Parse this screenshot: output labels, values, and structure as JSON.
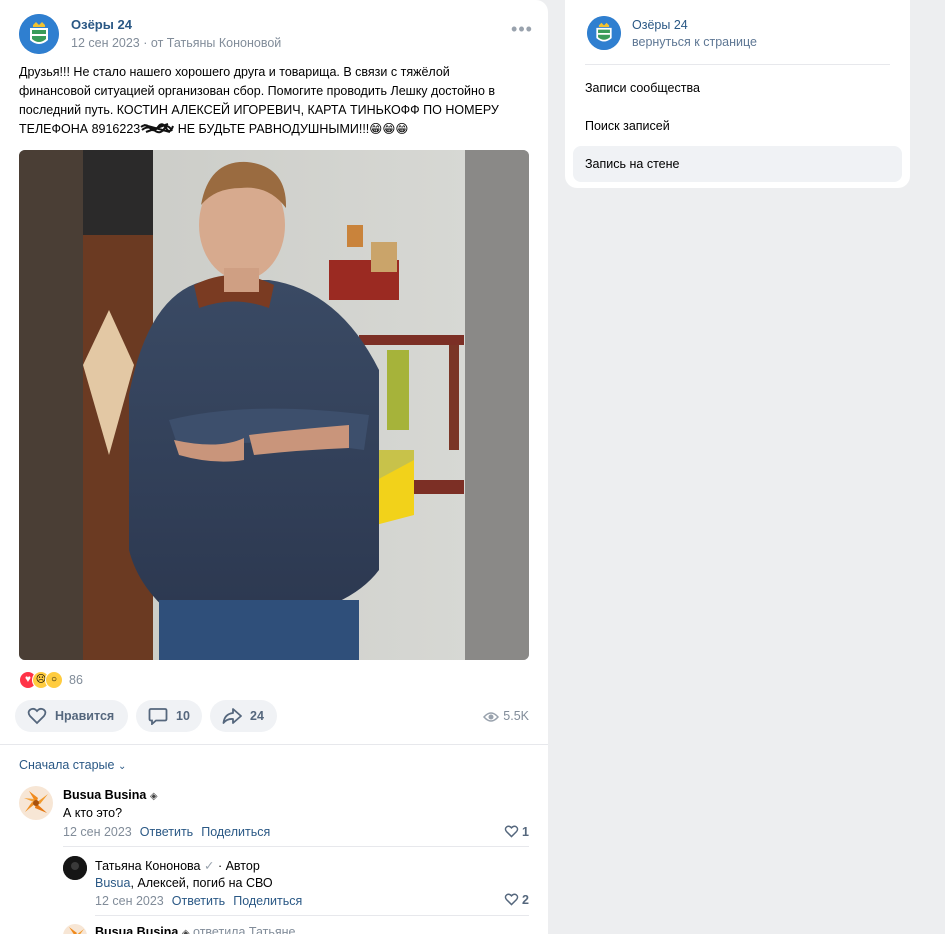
{
  "post": {
    "author": "Озёры 24",
    "date": "12 сен 2023",
    "from": "от Татьяны Кононовой",
    "more": "•••",
    "text_lines": [
      "Друзья!!! Не стало нашего хорошего друга и товарища. В связи с тяжёлой",
      "финансовой ситуацией организован сбор. Помогите проводить Лешку достойно в",
      "последний путь. КОСТИН АЛЕКСЕЙ ИГОРЕВИЧ, КАРТА ТИНЬКОФФ ПО НОМЕРУ",
      "ТЕЛЕФОНА 8916223"
    ],
    "text_tail": " НЕ БУДЬТЕ РАВНОДУШНЫМИ!!!😁😁😁",
    "reactions_count": "86",
    "like_label": "Нравится",
    "comments_count": "10",
    "shares_count": "24",
    "views": "5.5K"
  },
  "comments": {
    "sort_label": "Сначала старые",
    "items": [
      {
        "name": "Busua Busina",
        "text": "А кто это?",
        "date": "12 сен 2023",
        "reply": "Ответить",
        "share": "Поделиться",
        "likes": "1"
      },
      {
        "name": "Татьяна Кононова",
        "badge": "· Автор",
        "reply_to": "Busua",
        "text": ", Алексей, погиб на СВО",
        "date": "12 сен 2023",
        "reply": "Ответить",
        "share": "Поделиться",
        "likes": "2"
      },
      {
        "name": "Busua Busina",
        "answered": "ответила Татьяне"
      }
    ]
  },
  "sidebar": {
    "name": "Озёры 24",
    "back": "вернуться к странице",
    "items": [
      {
        "label": "Записи сообщества"
      },
      {
        "label": "Поиск записей"
      },
      {
        "label": "Запись на стене"
      }
    ]
  }
}
